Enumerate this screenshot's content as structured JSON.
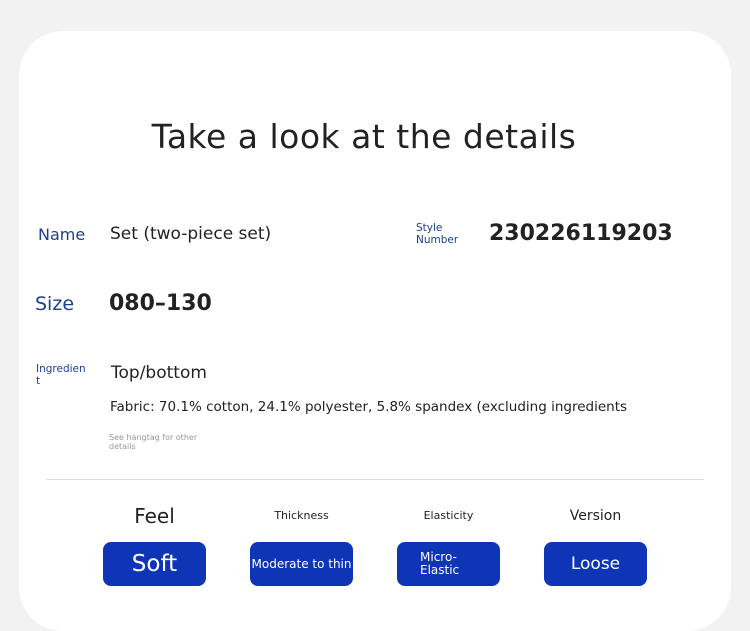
{
  "title": "Take a look at the details",
  "details": {
    "name_label": "Name",
    "name_value": "Set (two-piece set)",
    "style_label": "Style Number",
    "style_value": "230226119203",
    "size_label": "Size",
    "size_value": "080–130",
    "ingredient_label": "Ingredient",
    "ingredient_heading": "Top/bottom",
    "fabric": "Fabric: 70.1% cotton, 24.1% polyester, 5.8% spandex (excluding ingredients",
    "hangtag_note": "See hangtag for other details"
  },
  "features": [
    {
      "label": "Feel",
      "value": "Soft"
    },
    {
      "label": "Thickness",
      "value": "Moderate to thin"
    },
    {
      "label": "Elasticity",
      "value": "Micro-\nElastic"
    },
    {
      "label": "Version",
      "value": "Loose"
    }
  ],
  "colors": {
    "accent": "#0e35b5",
    "label_blue": "#1a3f8f"
  }
}
